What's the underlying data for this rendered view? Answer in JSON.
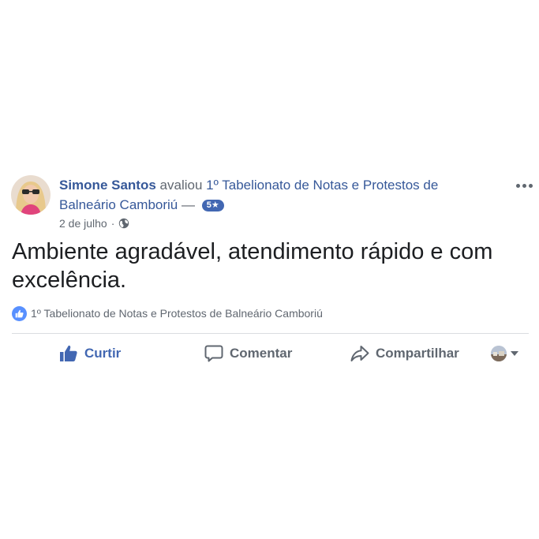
{
  "post": {
    "author": "Simone Santos",
    "verb": "avaliou",
    "page": "1º Tabelionato de Notas e Protestos de Balneário Camboriú",
    "dash": "—",
    "rating": "5★",
    "date": "2 de julho",
    "separator": "·",
    "body": "Ambiente agradável, atendimento rápido e com excelência.",
    "reaction_names": "1º Tabelionato de Notas e Protestos de Balneário Camboriú"
  },
  "actions": {
    "like": "Curtir",
    "comment": "Comentar",
    "share": "Compartilhar"
  },
  "icons": {
    "more": "more-options-icon",
    "audience": "globe-icon",
    "like": "thumbs-up-icon",
    "comment": "comment-bubble-icon",
    "share": "share-arrow-icon"
  },
  "colors": {
    "link": "#365899",
    "brand": "#4267b2",
    "muted": "#606770",
    "like_bubble": "#5890ff"
  }
}
